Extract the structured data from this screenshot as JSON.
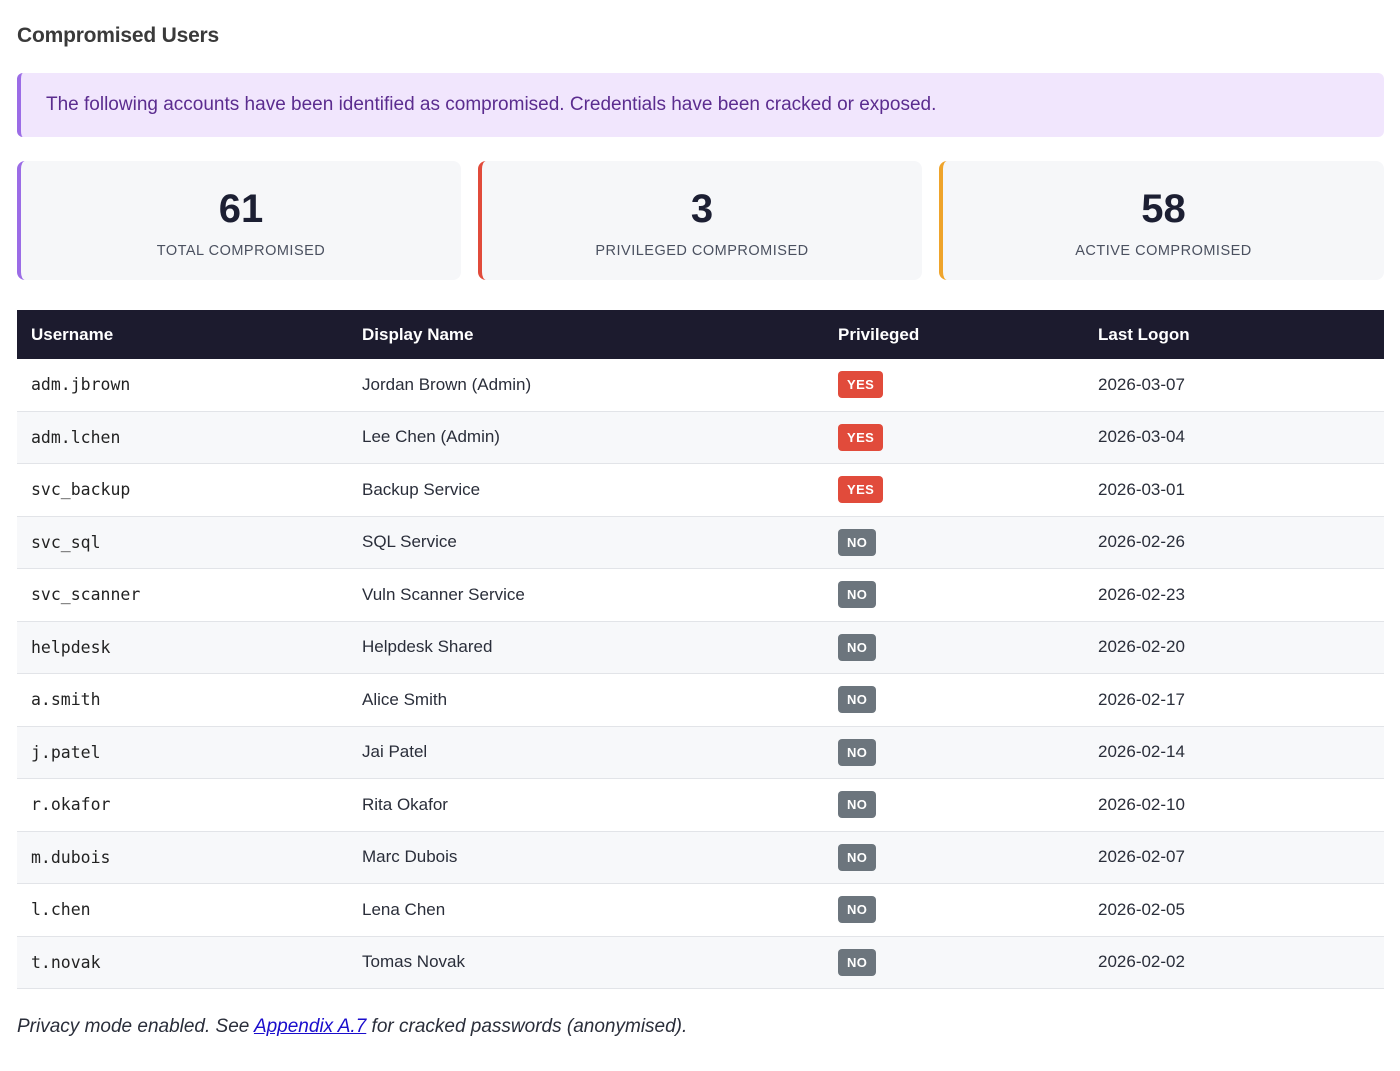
{
  "page": {
    "title": "Compromised Users"
  },
  "alert": {
    "text": "The following accounts have been identified as compromised. Credentials have been cracked or exposed."
  },
  "stats": [
    {
      "value": "61",
      "label": "TOTAL COMPROMISED",
      "accent": "#9b6ce6"
    },
    {
      "value": "3",
      "label": "PRIVILEGED COMPROMISED",
      "accent": "#e14b3b"
    },
    {
      "value": "58",
      "label": "ACTIVE COMPROMISED",
      "accent": "#efa42b"
    }
  ],
  "table": {
    "headers": [
      "Username",
      "Display Name",
      "Privileged",
      "Last Logon"
    ],
    "rows": [
      {
        "username": "adm.jbrown",
        "display_name": "Jordan Brown (Admin)",
        "privileged": "YES",
        "last_logon": "2026-03-07"
      },
      {
        "username": "adm.lchen",
        "display_name": "Lee Chen (Admin)",
        "privileged": "YES",
        "last_logon": "2026-03-04"
      },
      {
        "username": "svc_backup",
        "display_name": "Backup Service",
        "privileged": "YES",
        "last_logon": "2026-03-01"
      },
      {
        "username": "svc_sql",
        "display_name": "SQL Service",
        "privileged": "NO",
        "last_logon": "2026-02-26"
      },
      {
        "username": "svc_scanner",
        "display_name": "Vuln Scanner Service",
        "privileged": "NO",
        "last_logon": "2026-02-23"
      },
      {
        "username": "helpdesk",
        "display_name": "Helpdesk Shared",
        "privileged": "NO",
        "last_logon": "2026-02-20"
      },
      {
        "username": "a.smith",
        "display_name": "Alice Smith",
        "privileged": "NO",
        "last_logon": "2026-02-17"
      },
      {
        "username": "j.patel",
        "display_name": "Jai Patel",
        "privileged": "NO",
        "last_logon": "2026-02-14"
      },
      {
        "username": "r.okafor",
        "display_name": "Rita Okafor",
        "privileged": "NO",
        "last_logon": "2026-02-10"
      },
      {
        "username": "m.dubois",
        "display_name": "Marc Dubois",
        "privileged": "NO",
        "last_logon": "2026-02-07"
      },
      {
        "username": "l.chen",
        "display_name": "Lena Chen",
        "privileged": "NO",
        "last_logon": "2026-02-05"
      },
      {
        "username": "t.novak",
        "display_name": "Tomas Novak",
        "privileged": "NO",
        "last_logon": "2026-02-02"
      }
    ]
  },
  "footer": {
    "prefix": "Privacy mode enabled. See ",
    "link_text": "Appendix A.7",
    "suffix": " for cracked passwords (anonymised)."
  },
  "colors": {
    "badge_yes": "#e14b3b",
    "badge_no": "#6c757d",
    "table_header_bg": "#1c1b2e",
    "alert_bg": "#f1e6fd",
    "alert_border": "#9b6ce6"
  }
}
